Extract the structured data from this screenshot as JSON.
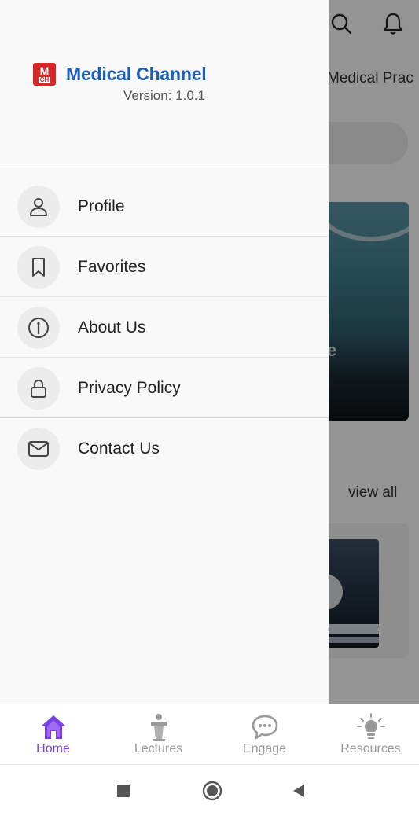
{
  "background": {
    "tab_partial": "Medical Prac",
    "view_all": "view all"
  },
  "drawer": {
    "app_name": "Medical Channel",
    "logo_top": "M",
    "logo_bottom": "CH",
    "version": "Version: 1.0.1",
    "menu": [
      {
        "label": "Profile",
        "icon": "person-icon"
      },
      {
        "label": "Favorites",
        "icon": "bookmark-icon"
      },
      {
        "label": "About Us",
        "icon": "info-icon"
      },
      {
        "label": "Privacy Policy",
        "icon": "lock-icon"
      },
      {
        "label": "Contact Us",
        "icon": "mail-icon"
      }
    ]
  },
  "bottom_nav": {
    "items": [
      {
        "label": "Home",
        "icon": "home-icon",
        "active": true
      },
      {
        "label": "Lectures",
        "icon": "lectern-icon",
        "active": false
      },
      {
        "label": "Engage",
        "icon": "chat-bubble-icon",
        "active": false
      },
      {
        "label": "Resources",
        "icon": "lightbulb-icon",
        "active": false
      }
    ]
  },
  "system_nav": {
    "buttons": [
      "recents-square",
      "home-circle",
      "back-triangle"
    ]
  },
  "colors": {
    "brand_blue": "#1d5fb4",
    "brand_red": "#d62828",
    "active_nav": "#7b3fe4",
    "inactive_nav": "#9a9a9a"
  }
}
